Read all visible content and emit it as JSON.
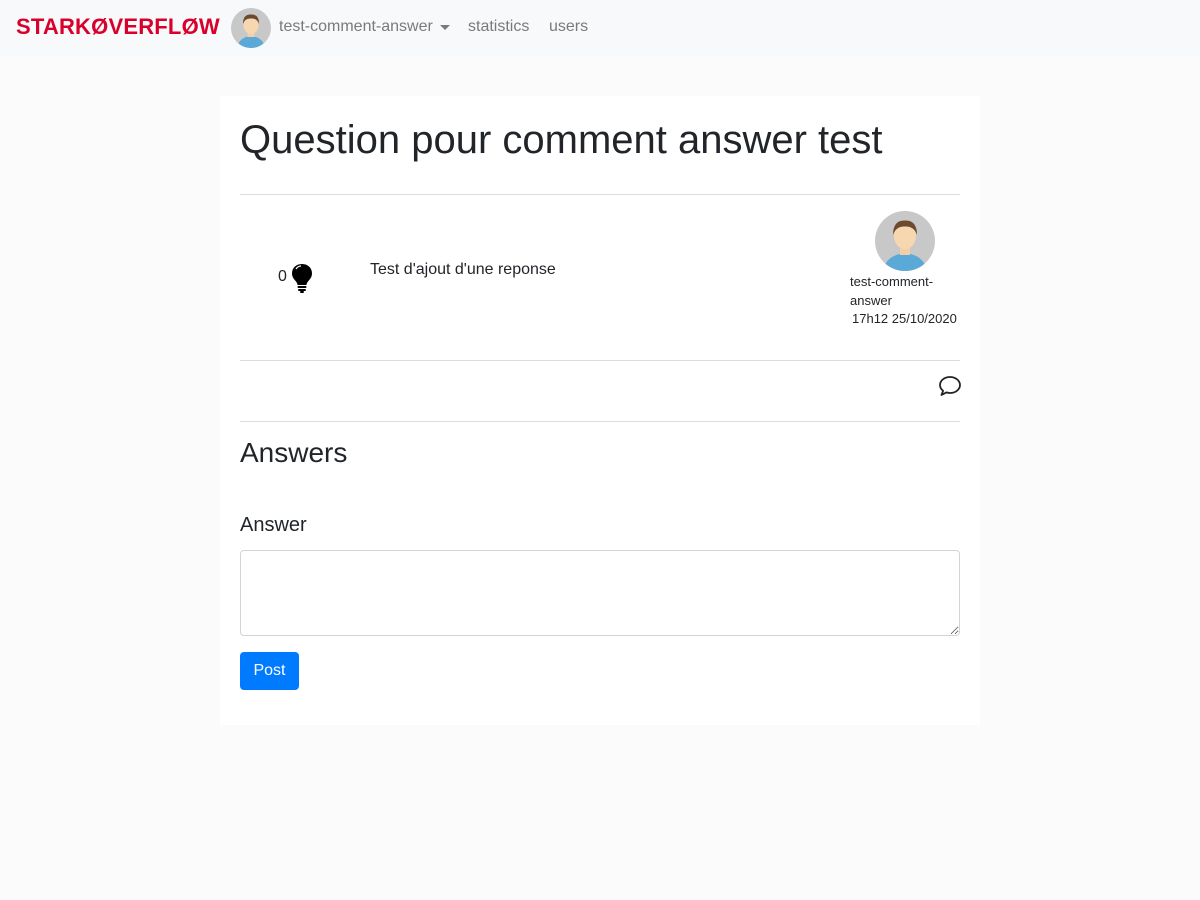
{
  "navbar": {
    "brand": "STARKØVERFLØW",
    "user_name": "test-comment-answer",
    "links": [
      "statistics",
      "users"
    ],
    "brand_color": "#d9002b"
  },
  "question": {
    "title": "Question pour comment answer test",
    "vote_count": "0",
    "body": "Test d'ajout d'une reponse",
    "author": "test-comment-answer",
    "date": "17h12 25/10/2020",
    "comment_icon": "chat-bubble-icon",
    "vote_icon": "lightbulb-icon"
  },
  "answers": {
    "heading": "Answers",
    "form_label": "Answer",
    "textarea_value": "",
    "post_label": "Post",
    "post_color": "#007bff"
  }
}
